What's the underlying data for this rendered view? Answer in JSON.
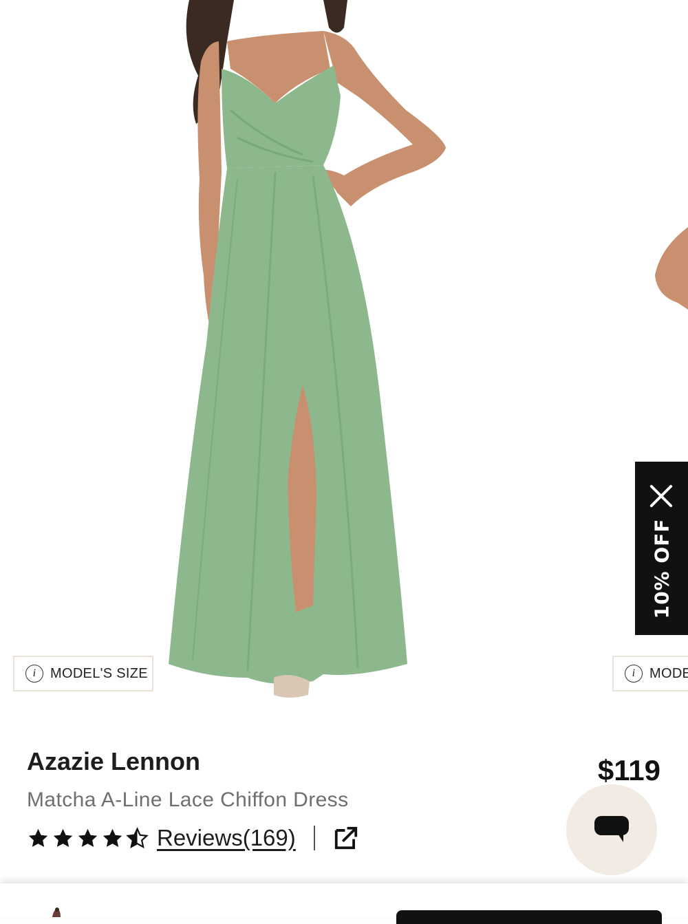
{
  "gallery": {
    "model_size_label": "MODEL'S SIZE",
    "model_size_label_next": "MODE",
    "main_image": "green-chiffon-dress-model-photo"
  },
  "promo": {
    "text": "10% OFF",
    "close_icon": "close-icon"
  },
  "product": {
    "brand": "Azazie Lennon",
    "name": "Matcha A-Line Lace Chiffon Dress",
    "price": "$119",
    "rating": 4.5,
    "rating_max": 5,
    "reviews_label": "Reviews(169)"
  },
  "icons": {
    "info": "info-icon",
    "share": "external-link-icon",
    "chat": "chat-bubble-icon"
  },
  "colors": {
    "dress_green": "#88b48a",
    "promo_bg": "#111111",
    "chat_bg": "#f2ebe3"
  }
}
